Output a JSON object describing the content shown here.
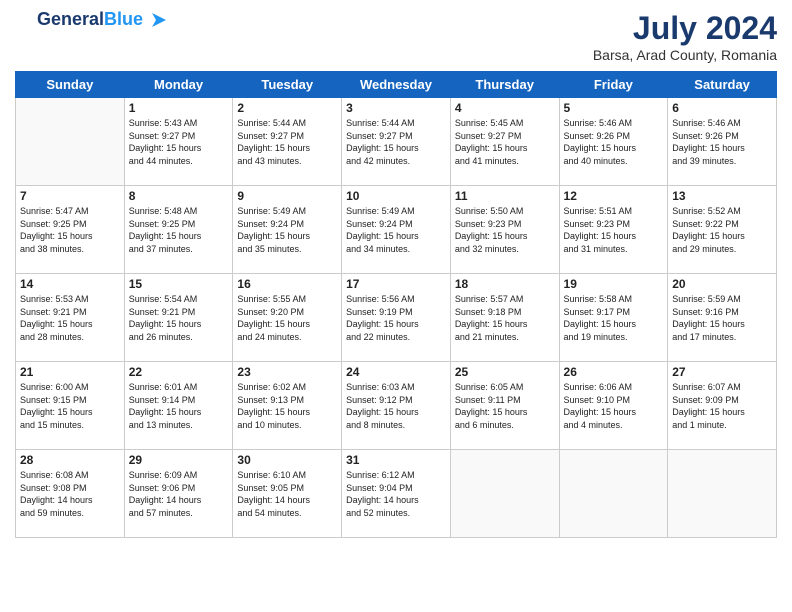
{
  "header": {
    "logo_line1": "General",
    "logo_line2": "Blue",
    "month": "July 2024",
    "location": "Barsa, Arad County, Romania"
  },
  "days_of_week": [
    "Sunday",
    "Monday",
    "Tuesday",
    "Wednesday",
    "Thursday",
    "Friday",
    "Saturday"
  ],
  "weeks": [
    [
      {
        "date": "",
        "content": ""
      },
      {
        "date": "1",
        "content": "Sunrise: 5:43 AM\nSunset: 9:27 PM\nDaylight: 15 hours\nand 44 minutes."
      },
      {
        "date": "2",
        "content": "Sunrise: 5:44 AM\nSunset: 9:27 PM\nDaylight: 15 hours\nand 43 minutes."
      },
      {
        "date": "3",
        "content": "Sunrise: 5:44 AM\nSunset: 9:27 PM\nDaylight: 15 hours\nand 42 minutes."
      },
      {
        "date": "4",
        "content": "Sunrise: 5:45 AM\nSunset: 9:27 PM\nDaylight: 15 hours\nand 41 minutes."
      },
      {
        "date": "5",
        "content": "Sunrise: 5:46 AM\nSunset: 9:26 PM\nDaylight: 15 hours\nand 40 minutes."
      },
      {
        "date": "6",
        "content": "Sunrise: 5:46 AM\nSunset: 9:26 PM\nDaylight: 15 hours\nand 39 minutes."
      }
    ],
    [
      {
        "date": "7",
        "content": "Sunrise: 5:47 AM\nSunset: 9:25 PM\nDaylight: 15 hours\nand 38 minutes."
      },
      {
        "date": "8",
        "content": "Sunrise: 5:48 AM\nSunset: 9:25 PM\nDaylight: 15 hours\nand 37 minutes."
      },
      {
        "date": "9",
        "content": "Sunrise: 5:49 AM\nSunset: 9:24 PM\nDaylight: 15 hours\nand 35 minutes."
      },
      {
        "date": "10",
        "content": "Sunrise: 5:49 AM\nSunset: 9:24 PM\nDaylight: 15 hours\nand 34 minutes."
      },
      {
        "date": "11",
        "content": "Sunrise: 5:50 AM\nSunset: 9:23 PM\nDaylight: 15 hours\nand 32 minutes."
      },
      {
        "date": "12",
        "content": "Sunrise: 5:51 AM\nSunset: 9:23 PM\nDaylight: 15 hours\nand 31 minutes."
      },
      {
        "date": "13",
        "content": "Sunrise: 5:52 AM\nSunset: 9:22 PM\nDaylight: 15 hours\nand 29 minutes."
      }
    ],
    [
      {
        "date": "14",
        "content": "Sunrise: 5:53 AM\nSunset: 9:21 PM\nDaylight: 15 hours\nand 28 minutes."
      },
      {
        "date": "15",
        "content": "Sunrise: 5:54 AM\nSunset: 9:21 PM\nDaylight: 15 hours\nand 26 minutes."
      },
      {
        "date": "16",
        "content": "Sunrise: 5:55 AM\nSunset: 9:20 PM\nDaylight: 15 hours\nand 24 minutes."
      },
      {
        "date": "17",
        "content": "Sunrise: 5:56 AM\nSunset: 9:19 PM\nDaylight: 15 hours\nand 22 minutes."
      },
      {
        "date": "18",
        "content": "Sunrise: 5:57 AM\nSunset: 9:18 PM\nDaylight: 15 hours\nand 21 minutes."
      },
      {
        "date": "19",
        "content": "Sunrise: 5:58 AM\nSunset: 9:17 PM\nDaylight: 15 hours\nand 19 minutes."
      },
      {
        "date": "20",
        "content": "Sunrise: 5:59 AM\nSunset: 9:16 PM\nDaylight: 15 hours\nand 17 minutes."
      }
    ],
    [
      {
        "date": "21",
        "content": "Sunrise: 6:00 AM\nSunset: 9:15 PM\nDaylight: 15 hours\nand 15 minutes."
      },
      {
        "date": "22",
        "content": "Sunrise: 6:01 AM\nSunset: 9:14 PM\nDaylight: 15 hours\nand 13 minutes."
      },
      {
        "date": "23",
        "content": "Sunrise: 6:02 AM\nSunset: 9:13 PM\nDaylight: 15 hours\nand 10 minutes."
      },
      {
        "date": "24",
        "content": "Sunrise: 6:03 AM\nSunset: 9:12 PM\nDaylight: 15 hours\nand 8 minutes."
      },
      {
        "date": "25",
        "content": "Sunrise: 6:05 AM\nSunset: 9:11 PM\nDaylight: 15 hours\nand 6 minutes."
      },
      {
        "date": "26",
        "content": "Sunrise: 6:06 AM\nSunset: 9:10 PM\nDaylight: 15 hours\nand 4 minutes."
      },
      {
        "date": "27",
        "content": "Sunrise: 6:07 AM\nSunset: 9:09 PM\nDaylight: 15 hours\nand 1 minute."
      }
    ],
    [
      {
        "date": "28",
        "content": "Sunrise: 6:08 AM\nSunset: 9:08 PM\nDaylight: 14 hours\nand 59 minutes."
      },
      {
        "date": "29",
        "content": "Sunrise: 6:09 AM\nSunset: 9:06 PM\nDaylight: 14 hours\nand 57 minutes."
      },
      {
        "date": "30",
        "content": "Sunrise: 6:10 AM\nSunset: 9:05 PM\nDaylight: 14 hours\nand 54 minutes."
      },
      {
        "date": "31",
        "content": "Sunrise: 6:12 AM\nSunset: 9:04 PM\nDaylight: 14 hours\nand 52 minutes."
      },
      {
        "date": "",
        "content": ""
      },
      {
        "date": "",
        "content": ""
      },
      {
        "date": "",
        "content": ""
      }
    ]
  ]
}
